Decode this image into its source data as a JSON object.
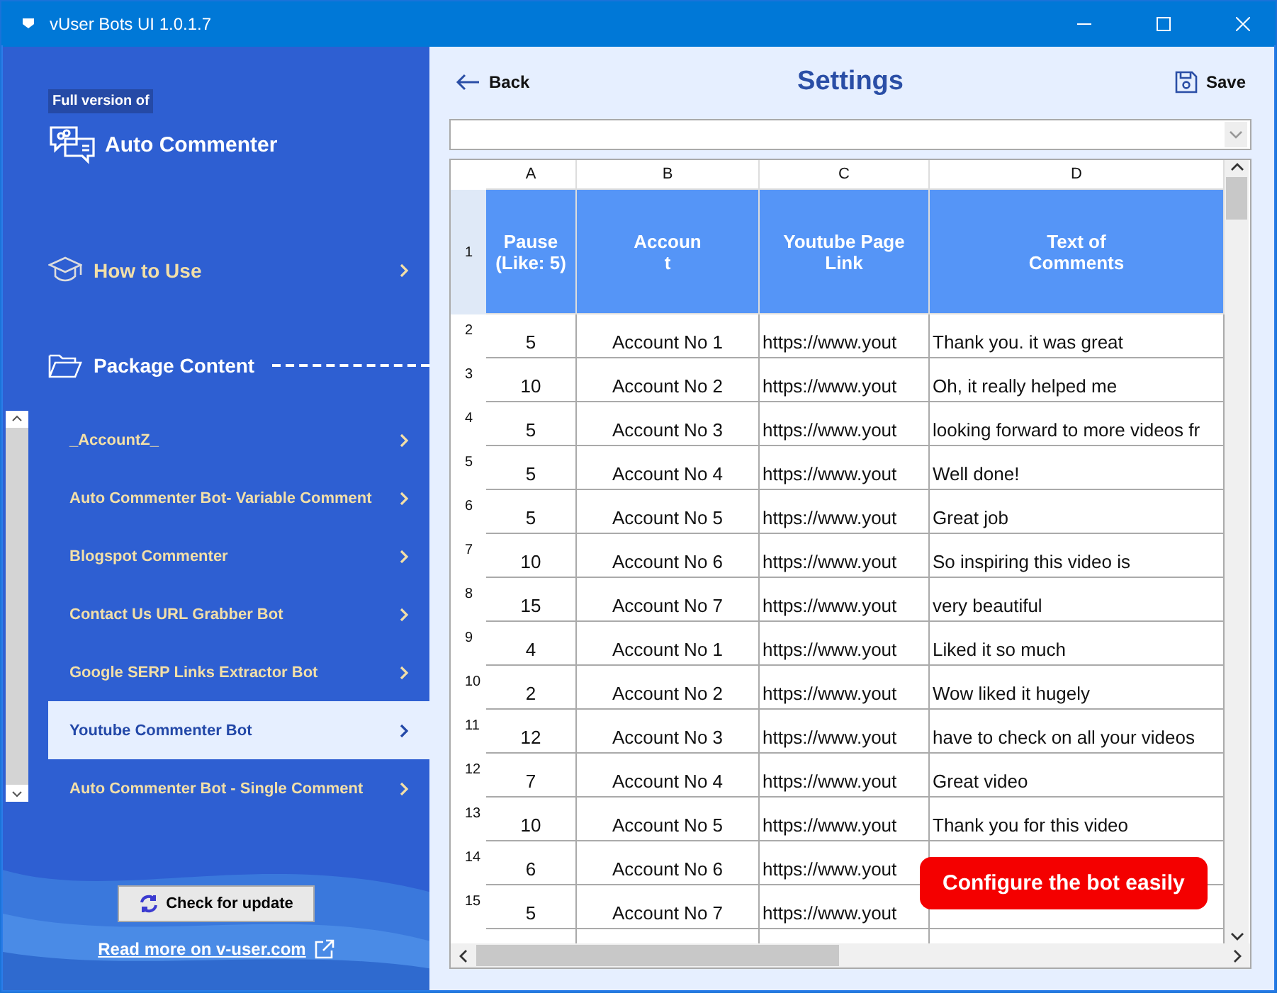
{
  "window": {
    "title": "vUser Bots UI 1.0.1.7"
  },
  "sidebar": {
    "badge": "Full version of",
    "app_name": "Auto Commenter",
    "how_to_use": "How to Use",
    "package_content": "Package Content",
    "items": [
      {
        "label": "_AccountZ_",
        "selected": false
      },
      {
        "label": "Auto Commenter Bot- Variable Comment",
        "selected": false
      },
      {
        "label": "Blogspot Commenter",
        "selected": false
      },
      {
        "label": "Contact Us URL Grabber Bot",
        "selected": false
      },
      {
        "label": "Google SERP Links Extractor Bot",
        "selected": false
      },
      {
        "label": "Youtube Commenter Bot",
        "selected": true
      },
      {
        "label": "Auto Commenter Bot - Single Comment",
        "selected": false
      }
    ],
    "update_button": "Check for update",
    "read_more": "Read more on v-user.com"
  },
  "header": {
    "back": "Back",
    "title": "Settings",
    "save": "Save"
  },
  "grid": {
    "columns": [
      "A",
      "B",
      "C",
      "D"
    ],
    "header_row": {
      "number": "1",
      "cells": [
        "Pause\n(Like: 5)",
        "Accoun\nt",
        "Youtube Page\nLink",
        "Text of\nComments"
      ]
    },
    "rows": [
      {
        "number": "2",
        "cells": [
          "5",
          "Account No 1",
          "https://www.yout",
          "Thank you. it was great"
        ]
      },
      {
        "number": "3",
        "cells": [
          "10",
          "Account No 2",
          "https://www.yout",
          "Oh, it really helped me"
        ]
      },
      {
        "number": "4",
        "cells": [
          "5",
          "Account No 3",
          "https://www.yout",
          "looking forward to more videos fr"
        ]
      },
      {
        "number": "5",
        "cells": [
          "5",
          "Account No 4",
          "https://www.yout",
          "Well done!"
        ]
      },
      {
        "number": "6",
        "cells": [
          "5",
          "Account No 5",
          "https://www.yout",
          "Great job"
        ]
      },
      {
        "number": "7",
        "cells": [
          "10",
          "Account No 6",
          "https://www.yout",
          "So inspiring this video is"
        ]
      },
      {
        "number": "8",
        "cells": [
          "15",
          "Account No 7",
          "https://www.yout",
          "very beautiful"
        ]
      },
      {
        "number": "9",
        "cells": [
          "4",
          "Account No 1",
          "https://www.yout",
          "Liked it so much"
        ]
      },
      {
        "number": "10",
        "cells": [
          "2",
          "Account No 2",
          "https://www.yout",
          "Wow liked it hugely"
        ]
      },
      {
        "number": "11",
        "cells": [
          "12",
          "Account No 3",
          "https://www.yout",
          "have to check on all your videos"
        ]
      },
      {
        "number": "12",
        "cells": [
          "7",
          "Account No 4",
          "https://www.yout",
          "Great video"
        ]
      },
      {
        "number": "13",
        "cells": [
          "10",
          "Account No 5",
          "https://www.yout",
          "Thank you for this video"
        ]
      },
      {
        "number": "14",
        "cells": [
          "6",
          "Account No 6",
          "https://www.yout",
          ""
        ]
      },
      {
        "number": "15",
        "cells": [
          "5",
          "Account No 7",
          "https://www.yout",
          ""
        ]
      }
    ]
  },
  "callout": "Configure the bot easily"
}
